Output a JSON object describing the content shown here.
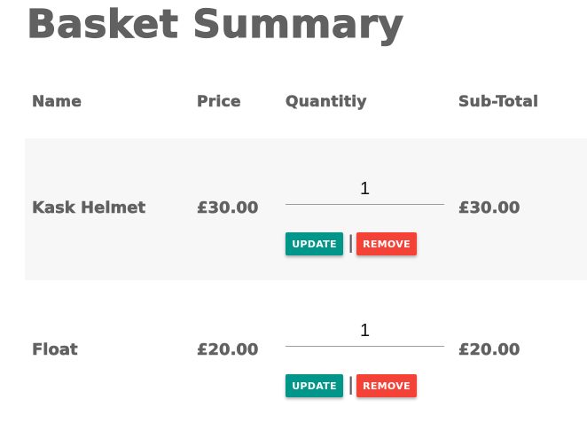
{
  "page": {
    "title": "Basket Summary"
  },
  "table": {
    "headers": [
      "Name",
      "Price",
      "Quantitiy",
      "Sub-Total"
    ],
    "separator": "|",
    "rows": [
      {
        "name": "Kask Helmet",
        "price": "£30.00",
        "quantity": "1",
        "subtotal": "£30.00",
        "update_label": "UPDATE",
        "remove_label": "REMOVE"
      },
      {
        "name": "Float",
        "price": "£20.00",
        "quantity": "1",
        "subtotal": "£20.00",
        "update_label": "UPDATE",
        "remove_label": "REMOVE"
      }
    ]
  },
  "colors": {
    "text": "#616161",
    "row_shade": "#f7f7f7",
    "update_button": "#00968a",
    "remove_button": "#f44336"
  }
}
